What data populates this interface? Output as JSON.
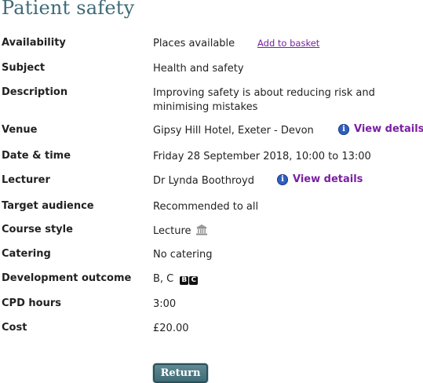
{
  "page": {
    "title": "Patient safety"
  },
  "details": {
    "availability": {
      "label": "Availability",
      "value": "Places available",
      "action": "Add to basket"
    },
    "subject": {
      "label": "Subject",
      "value": "Health and safety"
    },
    "description": {
      "label": "Description",
      "value": "Improving safety is about reducing risk and minimising mistakes"
    },
    "venue": {
      "label": "Venue",
      "value": "Gipsy Hill Hotel, Exeter - Devon",
      "action": "View details"
    },
    "date_time": {
      "label": "Date & time",
      "value": "Friday 28 September 2018, 10:00 to 13:00"
    },
    "lecturer": {
      "label": "Lecturer",
      "value": "Dr Lynda Boothroyd",
      "action": "View details"
    },
    "target_audience": {
      "label": "Target audience",
      "value": "Recommended to all"
    },
    "course_style": {
      "label": "Course style",
      "value": "Lecture",
      "icon": "lecture-building-icon"
    },
    "catering": {
      "label": "Catering",
      "value": "No catering"
    },
    "development_outcome": {
      "label": "Development outcome",
      "value": "B, C",
      "badges": [
        "B",
        "C"
      ]
    },
    "cpd_hours": {
      "label": "CPD hours",
      "value": "3:00"
    },
    "cost": {
      "label": "Cost",
      "value": "£20.00"
    }
  },
  "actions": {
    "return_label": "Return"
  },
  "colors": {
    "title": "#3e6a78",
    "link": "#7a1fa2",
    "info_icon": "#2f5fbf",
    "button": "#4f7a85"
  }
}
